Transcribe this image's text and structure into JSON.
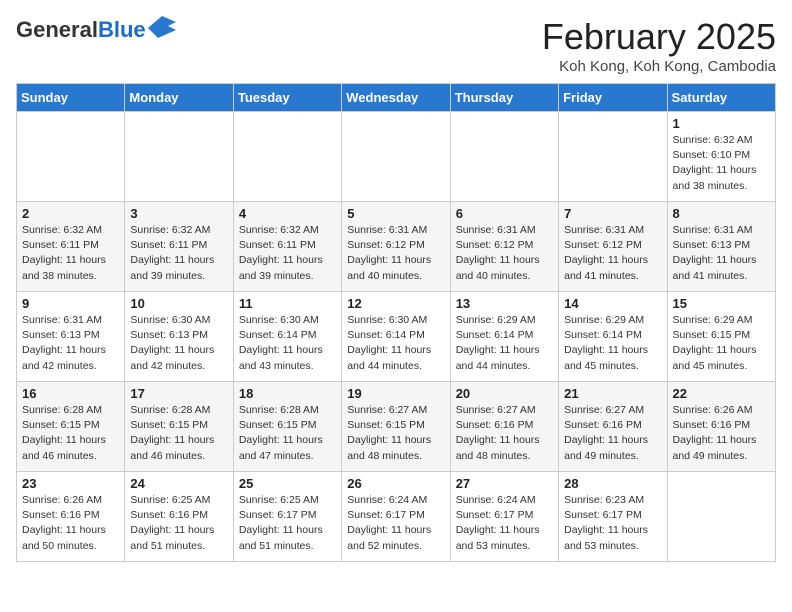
{
  "header": {
    "logo_general": "General",
    "logo_blue": "Blue",
    "title": "February 2025",
    "location": "Koh Kong, Koh Kong, Cambodia"
  },
  "days_of_week": [
    "Sunday",
    "Monday",
    "Tuesday",
    "Wednesday",
    "Thursday",
    "Friday",
    "Saturday"
  ],
  "weeks": [
    [
      {
        "day": "",
        "info": ""
      },
      {
        "day": "",
        "info": ""
      },
      {
        "day": "",
        "info": ""
      },
      {
        "day": "",
        "info": ""
      },
      {
        "day": "",
        "info": ""
      },
      {
        "day": "",
        "info": ""
      },
      {
        "day": "1",
        "info": "Sunrise: 6:32 AM\nSunset: 6:10 PM\nDaylight: 11 hours\nand 38 minutes."
      }
    ],
    [
      {
        "day": "2",
        "info": "Sunrise: 6:32 AM\nSunset: 6:11 PM\nDaylight: 11 hours\nand 38 minutes."
      },
      {
        "day": "3",
        "info": "Sunrise: 6:32 AM\nSunset: 6:11 PM\nDaylight: 11 hours\nand 39 minutes."
      },
      {
        "day": "4",
        "info": "Sunrise: 6:32 AM\nSunset: 6:11 PM\nDaylight: 11 hours\nand 39 minutes."
      },
      {
        "day": "5",
        "info": "Sunrise: 6:31 AM\nSunset: 6:12 PM\nDaylight: 11 hours\nand 40 minutes."
      },
      {
        "day": "6",
        "info": "Sunrise: 6:31 AM\nSunset: 6:12 PM\nDaylight: 11 hours\nand 40 minutes."
      },
      {
        "day": "7",
        "info": "Sunrise: 6:31 AM\nSunset: 6:12 PM\nDaylight: 11 hours\nand 41 minutes."
      },
      {
        "day": "8",
        "info": "Sunrise: 6:31 AM\nSunset: 6:13 PM\nDaylight: 11 hours\nand 41 minutes."
      }
    ],
    [
      {
        "day": "9",
        "info": "Sunrise: 6:31 AM\nSunset: 6:13 PM\nDaylight: 11 hours\nand 42 minutes."
      },
      {
        "day": "10",
        "info": "Sunrise: 6:30 AM\nSunset: 6:13 PM\nDaylight: 11 hours\nand 42 minutes."
      },
      {
        "day": "11",
        "info": "Sunrise: 6:30 AM\nSunset: 6:14 PM\nDaylight: 11 hours\nand 43 minutes."
      },
      {
        "day": "12",
        "info": "Sunrise: 6:30 AM\nSunset: 6:14 PM\nDaylight: 11 hours\nand 44 minutes."
      },
      {
        "day": "13",
        "info": "Sunrise: 6:29 AM\nSunset: 6:14 PM\nDaylight: 11 hours\nand 44 minutes."
      },
      {
        "day": "14",
        "info": "Sunrise: 6:29 AM\nSunset: 6:14 PM\nDaylight: 11 hours\nand 45 minutes."
      },
      {
        "day": "15",
        "info": "Sunrise: 6:29 AM\nSunset: 6:15 PM\nDaylight: 11 hours\nand 45 minutes."
      }
    ],
    [
      {
        "day": "16",
        "info": "Sunrise: 6:28 AM\nSunset: 6:15 PM\nDaylight: 11 hours\nand 46 minutes."
      },
      {
        "day": "17",
        "info": "Sunrise: 6:28 AM\nSunset: 6:15 PM\nDaylight: 11 hours\nand 46 minutes."
      },
      {
        "day": "18",
        "info": "Sunrise: 6:28 AM\nSunset: 6:15 PM\nDaylight: 11 hours\nand 47 minutes."
      },
      {
        "day": "19",
        "info": "Sunrise: 6:27 AM\nSunset: 6:15 PM\nDaylight: 11 hours\nand 48 minutes."
      },
      {
        "day": "20",
        "info": "Sunrise: 6:27 AM\nSunset: 6:16 PM\nDaylight: 11 hours\nand 48 minutes."
      },
      {
        "day": "21",
        "info": "Sunrise: 6:27 AM\nSunset: 6:16 PM\nDaylight: 11 hours\nand 49 minutes."
      },
      {
        "day": "22",
        "info": "Sunrise: 6:26 AM\nSunset: 6:16 PM\nDaylight: 11 hours\nand 49 minutes."
      }
    ],
    [
      {
        "day": "23",
        "info": "Sunrise: 6:26 AM\nSunset: 6:16 PM\nDaylight: 11 hours\nand 50 minutes."
      },
      {
        "day": "24",
        "info": "Sunrise: 6:25 AM\nSunset: 6:16 PM\nDaylight: 11 hours\nand 51 minutes."
      },
      {
        "day": "25",
        "info": "Sunrise: 6:25 AM\nSunset: 6:17 PM\nDaylight: 11 hours\nand 51 minutes."
      },
      {
        "day": "26",
        "info": "Sunrise: 6:24 AM\nSunset: 6:17 PM\nDaylight: 11 hours\nand 52 minutes."
      },
      {
        "day": "27",
        "info": "Sunrise: 6:24 AM\nSunset: 6:17 PM\nDaylight: 11 hours\nand 53 minutes."
      },
      {
        "day": "28",
        "info": "Sunrise: 6:23 AM\nSunset: 6:17 PM\nDaylight: 11 hours\nand 53 minutes."
      },
      {
        "day": "",
        "info": ""
      }
    ]
  ]
}
